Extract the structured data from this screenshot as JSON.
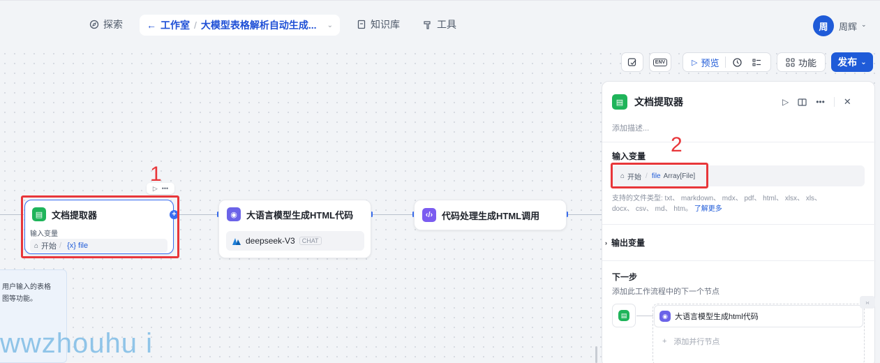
{
  "nav": {
    "explore": "探索",
    "knowledge": "知识库",
    "tools": "工具"
  },
  "breadcrumb": {
    "workspace": "工作室",
    "separator": "/",
    "current": "大模型表格解析自动生成..."
  },
  "user": {
    "avatar_char": "周",
    "name": "周辉"
  },
  "toolbar": {
    "env": "ENV",
    "preview": "预览",
    "features": "功能",
    "publish": "发布"
  },
  "nodes": {
    "doc_extractor": {
      "title": "文档提取器",
      "input_label": "输入变量",
      "source": "开始",
      "var": "{x} file"
    },
    "llm": {
      "title": "大语言模型生成HTML代码",
      "model": "deepseek-V3",
      "badge": "CHAT"
    },
    "code": {
      "title": "代码处理生成HTML调用"
    }
  },
  "note": {
    "line1": "用户输入的表格",
    "line2": "图等功能。"
  },
  "annotations": {
    "one": "1",
    "two": "2"
  },
  "panel": {
    "title": "文档提取器",
    "desc_placeholder": "添加描述...",
    "input_title": "输入变量",
    "input_source": "开始",
    "input_sep": "/",
    "input_var": "file",
    "input_type": "Array[File]",
    "filetypes_line1": "支持的文件类型: txt、 markdown、 mdx、 pdf、 html、 xlsx、 xls、",
    "filetypes_line2": "docx、 csv、 md、 htm。",
    "learn_more": "了解更多",
    "output_title": "输出变量",
    "next_title": "下一步",
    "next_desc": "添加此工作流程中的下一个节点",
    "next_node": "大语言模型生成html代码",
    "add_parallel": "添加并行节点"
  },
  "watermark": "wwzhouhu i",
  "colors": {
    "accent": "#1f5bd8",
    "red": "#e8363a",
    "green": "#1fb45a"
  }
}
